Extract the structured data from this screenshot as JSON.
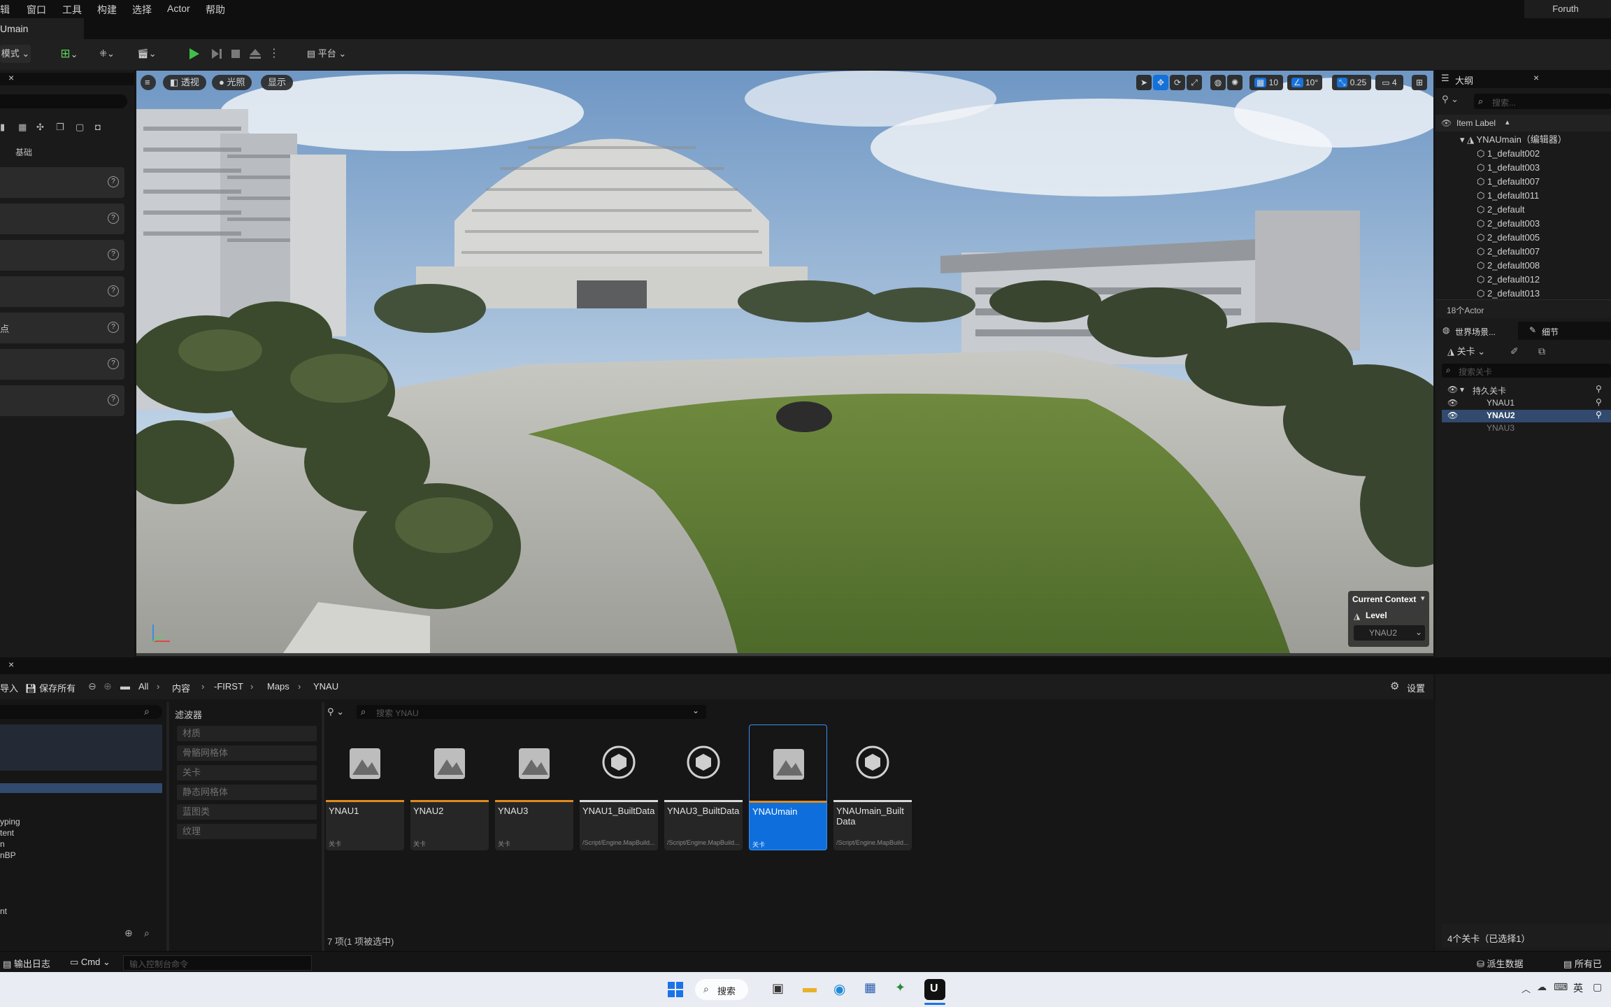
{
  "menu": {
    "items": [
      "辑",
      "窗口",
      "工具",
      "构建",
      "选择",
      "Actor",
      "帮助"
    ],
    "project_name": "Foruth"
  },
  "tab": {
    "level_name": "Umain"
  },
  "toolbar": {
    "mode_label": "模式",
    "platform_label": "平台"
  },
  "left_panel": {
    "category_label": "基础",
    "row_labels": [
      "",
      "",
      "",
      "",
      "点",
      "",
      ""
    ]
  },
  "viewport": {
    "perspective_label": "透视",
    "lit_label": "光照",
    "show_label": "显示",
    "grid_snap_value": "10",
    "rotation_snap_value": "10°",
    "scale_snap_value": "0.25",
    "camera_speed_value": "4",
    "context_title": "Current Context",
    "context_level_label": "Level",
    "context_level_value": "YNAU2"
  },
  "outliner": {
    "title": "大纲",
    "search_placeholder": "搜索...",
    "column_label": "Item Label",
    "root_label": "YNAUmain（编辑器）",
    "items": [
      "1_default002",
      "1_default003",
      "1_default007",
      "1_default011",
      "2_default",
      "2_default003",
      "2_default005",
      "2_default007",
      "2_default008",
      "2_default012",
      "2_default013"
    ],
    "actor_count": "18个Actor"
  },
  "levels_panel": {
    "tab_world": "世界场景...",
    "tab_details": "细节",
    "levels_dropdown": "关卡",
    "search_placeholder": "搜索关卡",
    "persistent_label": "持久关卡",
    "levels": [
      "YNAU1",
      "YNAU2",
      "YNAU3"
    ],
    "summary": "4个关卡（已选择1）"
  },
  "content_browser": {
    "import_label": "导入",
    "save_all_label": "保存所有",
    "breadcrumb": [
      "All",
      "内容",
      "-FIRST",
      "Maps",
      "YNAU"
    ],
    "settings_label": "设置",
    "search_placeholder": "搜索 YNAU",
    "filters_title": "滤波器",
    "filters": [
      "材质",
      "骨骼网格体",
      "关卡",
      "静态网格体",
      "蓝图类",
      "纹理"
    ],
    "tree_items": [
      "yping",
      "tent",
      "n",
      "nBP",
      "nt"
    ],
    "assets": [
      {
        "name": "YNAU1",
        "type": "关卡",
        "kind": "level"
      },
      {
        "name": "YNAU2",
        "type": "关卡",
        "kind": "level"
      },
      {
        "name": "YNAU3",
        "type": "关卡",
        "kind": "level"
      },
      {
        "name": "YNAU1_BuiltData",
        "type": "/Script/Engine.MapBuild...",
        "kind": "data"
      },
      {
        "name": "YNAU3_BuiltData",
        "type": "/Script/Engine.MapBuild...",
        "kind": "data"
      },
      {
        "name": "YNAUmain",
        "type": "关卡",
        "kind": "level"
      },
      {
        "name": "YNAUmain_BuiltData",
        "type": "/Script/Engine.MapBuild...",
        "kind": "data"
      }
    ],
    "item_count": "7 项(1 项被选中)"
  },
  "statusbar": {
    "output_log_label": "输出日志",
    "cmd_label": "Cmd",
    "console_placeholder": "输入控制台命令",
    "derived_data_label": "派生数据",
    "all_saved_label": "所有已"
  },
  "taskbar": {
    "search_label": "搜索",
    "ime_label": "英"
  },
  "colors": {
    "accent": "#0e6fdc",
    "level_underline": "#e08a1e",
    "selected_row": "#314a6e",
    "play_green": "#3fbf4a"
  }
}
